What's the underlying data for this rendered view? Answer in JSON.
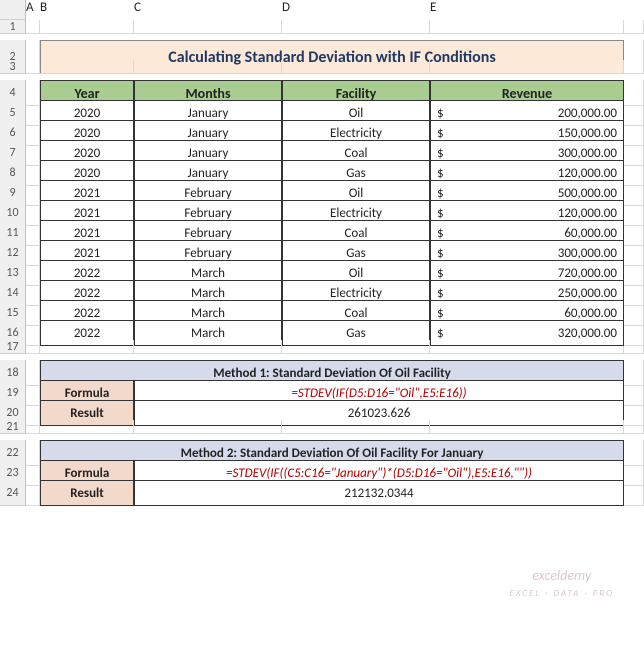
{
  "cols": [
    "A",
    "B",
    "C",
    "D",
    "E"
  ],
  "title": "Calculating Standard Deviation with IF Conditions",
  "headers": {
    "year": "Year",
    "months": "Months",
    "facility": "Facility",
    "revenue": "Revenue"
  },
  "rows": [
    {
      "year": "2020",
      "month": "January",
      "facility": "Oil",
      "revenue": "200,000.00"
    },
    {
      "year": "2020",
      "month": "January",
      "facility": "Electricity",
      "revenue": "150,000.00"
    },
    {
      "year": "2020",
      "month": "January",
      "facility": "Coal",
      "revenue": "300,000.00"
    },
    {
      "year": "2020",
      "month": "January",
      "facility": "Gas",
      "revenue": "120,000.00"
    },
    {
      "year": "2021",
      "month": "February",
      "facility": "Oil",
      "revenue": "500,000.00"
    },
    {
      "year": "2021",
      "month": "February",
      "facility": "Electricity",
      "revenue": "120,000.00"
    },
    {
      "year": "2021",
      "month": "February",
      "facility": "Coal",
      "revenue": "60,000.00"
    },
    {
      "year": "2021",
      "month": "February",
      "facility": "Gas",
      "revenue": "300,000.00"
    },
    {
      "year": "2022",
      "month": "March",
      "facility": "Oil",
      "revenue": "720,000.00"
    },
    {
      "year": "2022",
      "month": "March",
      "facility": "Electricity",
      "revenue": "250,000.00"
    },
    {
      "year": "2022",
      "month": "March",
      "facility": "Coal",
      "revenue": "60,000.00"
    },
    {
      "year": "2022",
      "month": "March",
      "facility": "Gas",
      "revenue": "320,000.00"
    }
  ],
  "method1": {
    "title": "Method 1: Standard Deviation Of Oil Facility",
    "formula_label": "Formula",
    "formula": "=STDEV(IF(D5:D16=\"Oil\",E5:E16))",
    "result_label": "Result",
    "result": "261023.626"
  },
  "method2": {
    "title": "Method 2: Standard Deviation Of Oil Facility For January",
    "formula_label": "Formula",
    "formula": "=STDEV(IF((C5:C16=\"January\")*(D5:D16=\"Oil\"),E5:E16,\"\"))",
    "result_label": "Result",
    "result": "212132.0344"
  },
  "currency": "$",
  "watermark": {
    "main": "exceldemy",
    "sub": "EXCEL · DATA · PRO"
  }
}
